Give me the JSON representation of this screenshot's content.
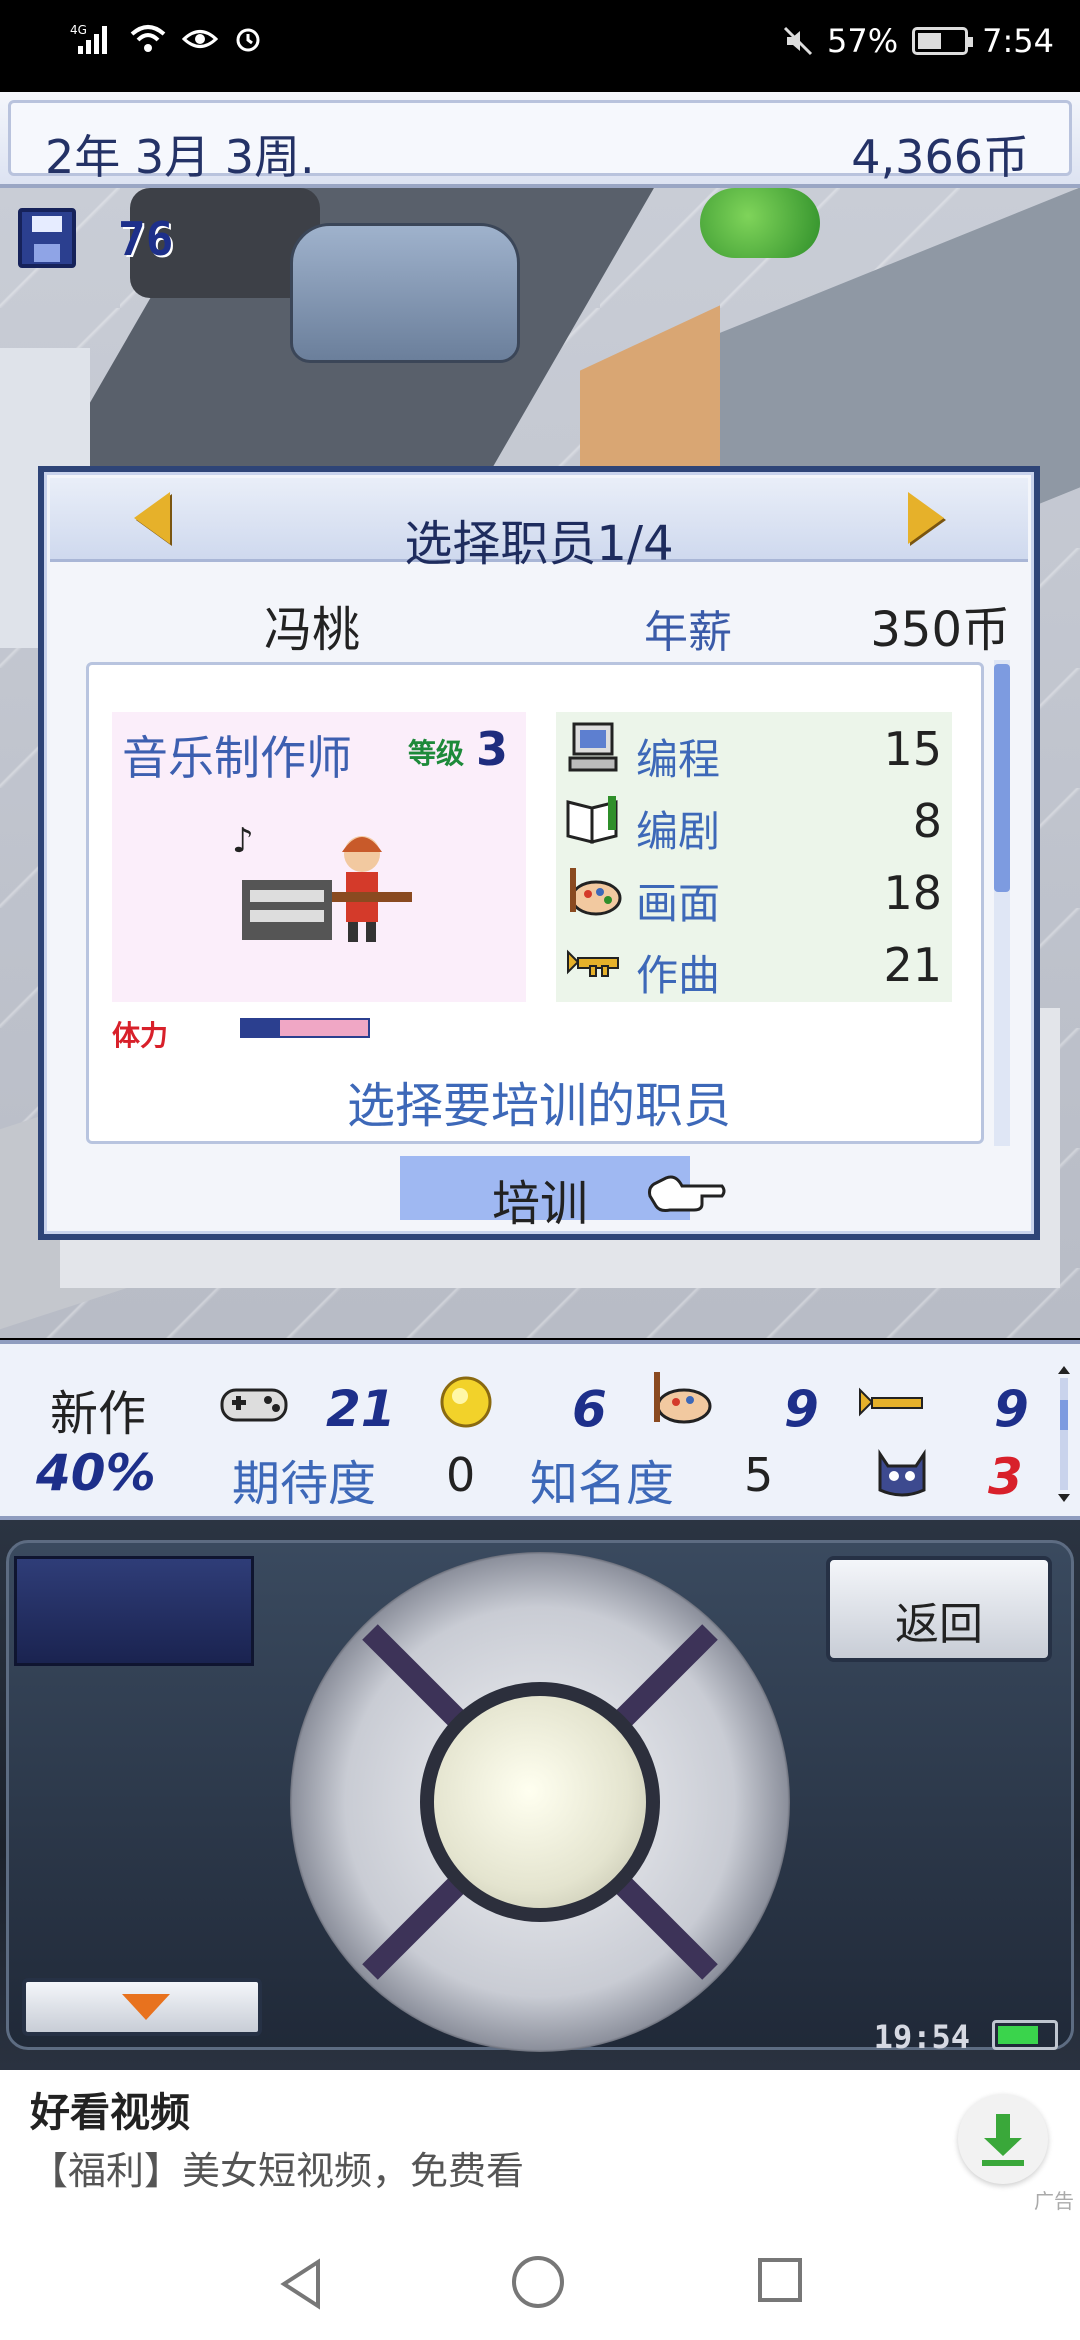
{
  "status_bar": {
    "network": "4G",
    "battery_pct": "57%",
    "time": "7:54",
    "icons": [
      "signal-icon",
      "wifi-icon",
      "eye-icon",
      "alarm-icon",
      "mute-icon",
      "battery-icon"
    ],
    "battery_level": 0.57
  },
  "game_header": {
    "date": "2年 3月 3周.",
    "money": "4,366币"
  },
  "save": {
    "count": "76"
  },
  "dialog": {
    "title": "选择职员1/4",
    "employee_name": "冯桃",
    "salary_label": "年薪",
    "salary_value": "350币",
    "job_title": "音乐制作师",
    "level_label": "等级",
    "level": "3",
    "stamina_label": "体力",
    "stamina_level": 0.3,
    "stats": [
      {
        "label": "编程",
        "value": "15",
        "icon": "computer-icon"
      },
      {
        "label": "编剧",
        "value": "8",
        "icon": "book-icon"
      },
      {
        "label": "画面",
        "value": "18",
        "icon": "palette-icon"
      },
      {
        "label": "作曲",
        "value": "21",
        "icon": "trumpet-icon"
      }
    ],
    "hint": "选择要培训的职员",
    "train_label": "培训"
  },
  "info_bar": {
    "new_label": "新作",
    "progress_pct": "40%",
    "gamepad_value": "21",
    "coin_value": "6",
    "palette_value": "9",
    "trumpet_value": "9",
    "expectation_label": "期待度",
    "expectation_value": "0",
    "fame_label": "知名度",
    "fame_value": "5",
    "monster_value": "3"
  },
  "controller": {
    "back_label": "返回",
    "clock": "19:54"
  },
  "ad": {
    "title": "好看视频",
    "desc": "【福利】美女短视频，免费看",
    "tag": "广告"
  },
  "colors": {
    "accent": "#1d2f8a",
    "label_blue": "#3d68b8",
    "dialog_border": "#2e4477"
  }
}
